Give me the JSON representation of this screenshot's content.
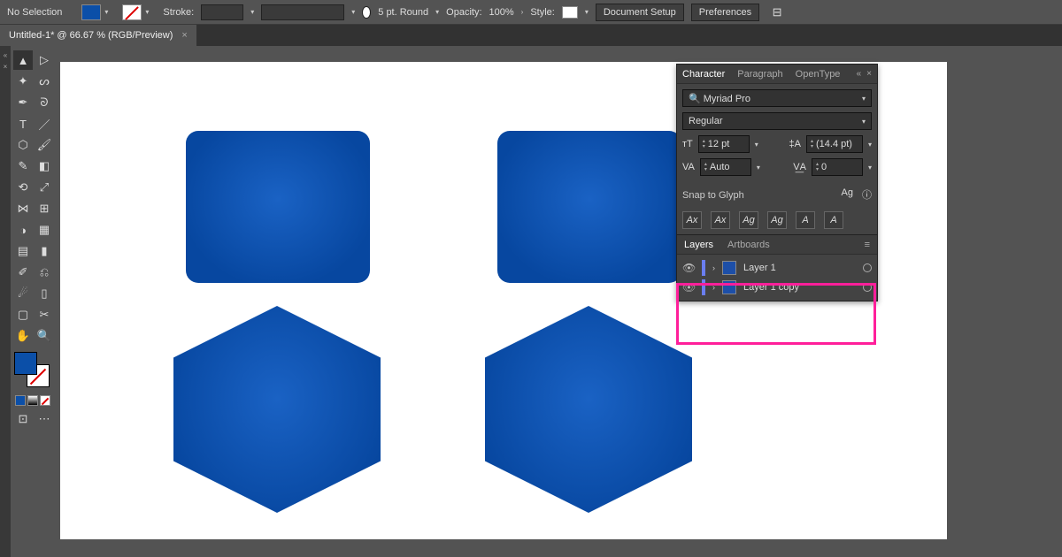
{
  "topbar": {
    "selection": "No Selection",
    "stroke_label": "Stroke:",
    "stroke_weight": "5 pt. Round",
    "opacity_label": "Opacity:",
    "opacity_value": "100%",
    "style_label": "Style:",
    "doc_setup": "Document Setup",
    "preferences": "Preferences"
  },
  "tab": {
    "title": "Untitled-1* @ 66.67 % (RGB/Preview)",
    "close": "×"
  },
  "character_panel": {
    "tabs": [
      "Character",
      "Paragraph",
      "OpenType"
    ],
    "active_tab": 0,
    "font_family": "Myriad Pro",
    "font_style": "Regular",
    "font_size": "12 pt",
    "leading": "(14.4 pt)",
    "kerning": "Auto",
    "tracking": "0",
    "snap_label": "Snap to Glyph",
    "glyph_icons": [
      "Ax",
      "Ax",
      "Ag",
      "Ag",
      "A",
      "A"
    ]
  },
  "layers_panel": {
    "tabs": [
      "Layers",
      "Artboards"
    ],
    "active_tab": 0,
    "layers": [
      {
        "name": "Layer 1"
      },
      {
        "name": "Layer 1 copy"
      }
    ]
  },
  "colors": {
    "shape_fill": "#0b4fa8",
    "highlight": "#ff1f9a"
  }
}
